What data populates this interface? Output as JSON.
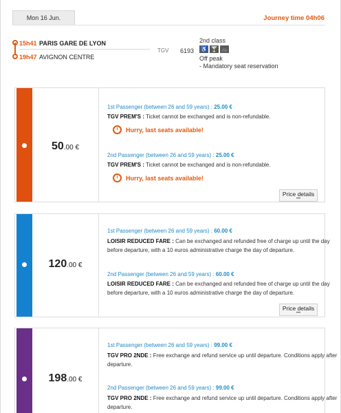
{
  "header": {
    "date": "Mon 16 Jun.",
    "journey_label": "Journey time",
    "journey_time": "04h06"
  },
  "trip": {
    "departure_time": "15h41",
    "departure_station": "PARIS GARE DE LYON",
    "arrival_time": "19h47",
    "arrival_station": "AVIGNON CENTRE",
    "train_type": "TGV",
    "train_number": "6193",
    "class": "2nd class",
    "service_icons": [
      "accessible-icon",
      "bar-icon",
      "bicycle-icon"
    ],
    "peak": "Off peak",
    "reservation": "- Mandatory seat reservation"
  },
  "fares": [
    {
      "color": "#e0500f",
      "price_main": "50",
      "price_cents": ".00 €",
      "passengers": [
        {
          "label": "1st Passenger (between 26 and 59 years) :",
          "price": "25.00 €",
          "fare_name": "TGV PREM'S :",
          "condition": "Ticket cannot be exchanged and is non-refundable.",
          "alert": "Hurry, last seats available!"
        },
        {
          "label": "2nd Passenger (between 26 and 59 years) :",
          "price": "25.00 €",
          "fare_name": "TGV PREM'S :",
          "condition": "Ticket cannot be exchanged and is non-refundable.",
          "alert": "Hurry, last seats available!"
        }
      ],
      "details_label": "Price details"
    },
    {
      "color": "#1582d0",
      "price_main": "120",
      "price_cents": ".00 €",
      "passengers": [
        {
          "label": "1st Passenger (between 26 and 59 years) :",
          "price": "60.00 €",
          "fare_name": "LOISIR REDUCED FARE :",
          "condition": "Can be exchanged and refunded free of charge up until the day before departure, with a 10 euros administrative charge the day of departure."
        },
        {
          "label": "2nd Passenger (between 26 and 59 years) :",
          "price": "60.00 €",
          "fare_name": "LOISIR REDUCED FARE :",
          "condition": "Can be exchanged and refunded free of charge up until the day before departure, with a 10 euros administrative charge the day of departure."
        }
      ],
      "details_label": "Price details"
    },
    {
      "color": "#6a2f88",
      "price_main": "198",
      "price_cents": ".00 €",
      "passengers": [
        {
          "label": "1st Passenger (between 26 and 59 years) :",
          "price": "99.00 €",
          "fare_name": "TGV PRO 2NDE :",
          "condition": "Free exchange and refund service up until departure. Conditions apply after departure."
        },
        {
          "label": "2nd Passenger (between 26 and 59 years) :",
          "price": "99.00 €",
          "fare_name": "TGV PRO 2NDE :",
          "condition": "Free exchange and refund service up until departure. Conditions apply after departure."
        }
      ]
    }
  ]
}
